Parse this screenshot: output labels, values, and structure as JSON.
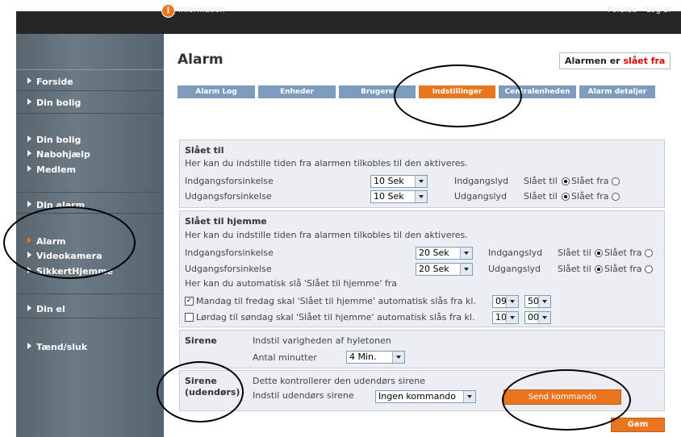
{
  "topbar": {
    "info_label": "Information",
    "info_icon": "i",
    "forside": "Forside",
    "logaf": "Log af"
  },
  "sidebar": {
    "items": [
      {
        "label": "Forside"
      },
      {
        "label": "Din bolig"
      },
      {
        "label": "Din bolig"
      },
      {
        "label": "Nabohjælp"
      },
      {
        "label": "Medlem"
      },
      {
        "label": "Din alarm"
      },
      {
        "label": "Alarm",
        "active": true
      },
      {
        "label": "Videokamera"
      },
      {
        "label": "SikkertHjemme"
      },
      {
        "label": "Din el"
      },
      {
        "label": "Tænd/sluk"
      }
    ]
  },
  "main": {
    "title": "Alarm",
    "status_prefix": "Alarmen er ",
    "status_value": "slået fra",
    "status_color": "#e00000",
    "tabs": [
      {
        "label": "Alarm Log"
      },
      {
        "label": "Enheder"
      },
      {
        "label": "Brugere"
      },
      {
        "label": "Indstillinger",
        "active": true
      },
      {
        "label": "Centralenheden"
      },
      {
        "label": "Alarm detaljer"
      }
    ],
    "accent_color": "#e8761e",
    "tab_color": "#7d9bbc"
  },
  "slaaet_til": {
    "title": "Slået til",
    "description": "Her kan du indstille tiden fra alarmen tilkobles til den aktiveres.",
    "rows": [
      {
        "label": "Indgangsforsinkelse",
        "value": "10 Sek",
        "sound_label": "Indgangslyd",
        "on_label": "Slået til",
        "off_label": "Slået fra",
        "selected": "on"
      },
      {
        "label": "Udgangsforsinkelse",
        "value": "10 Sek",
        "sound_label": "Udgangslyd",
        "on_label": "Slået til",
        "off_label": "Slået fra",
        "selected": "on"
      }
    ]
  },
  "slaaet_til_hjemme": {
    "title": "Slået til hjemme",
    "description": "Her kan du indstille tiden fra alarmen tilkobles til den aktiveres.",
    "rows": [
      {
        "label": "Indgangsforsinkelse",
        "value": "20 Sek",
        "sound_label": "Indgangslyd",
        "on_label": "Slået til",
        "off_label": "Slået fra",
        "selected": "on"
      },
      {
        "label": "Udgangsforsinkelse",
        "value": "20 Sek",
        "sound_label": "Udgangslyd",
        "on_label": "Slået til",
        "off_label": "Slået fra",
        "selected": "on"
      }
    ],
    "auto_text": "Her kan du automatisk slå 'Slået til hjemme' fra",
    "schedules": [
      {
        "label": "Mandag til fredag skal 'Slået til hjemme' automatisk slås fra kl.",
        "checked": true,
        "hour": "09",
        "minute": "50"
      },
      {
        "label": "Lørdag til søndag skal 'Slået til hjemme' automatisk slås fra kl.",
        "checked": false,
        "hour": "10",
        "minute": "00"
      }
    ]
  },
  "sirene": {
    "title": "Sirene",
    "description": "Indstil varigheden af hyletonen",
    "minutes_label": "Antal minutter",
    "minutes_value": "4 Min."
  },
  "sirene_ude": {
    "title": "Sirene",
    "title2": "(udendørs)",
    "description": "Dette kontrollerer den udendørs sirene",
    "control_label": "Indstil udendørs sirene",
    "control_value": "Ingen kommando",
    "send_label": "Send kommando"
  },
  "save_label": "Gem"
}
